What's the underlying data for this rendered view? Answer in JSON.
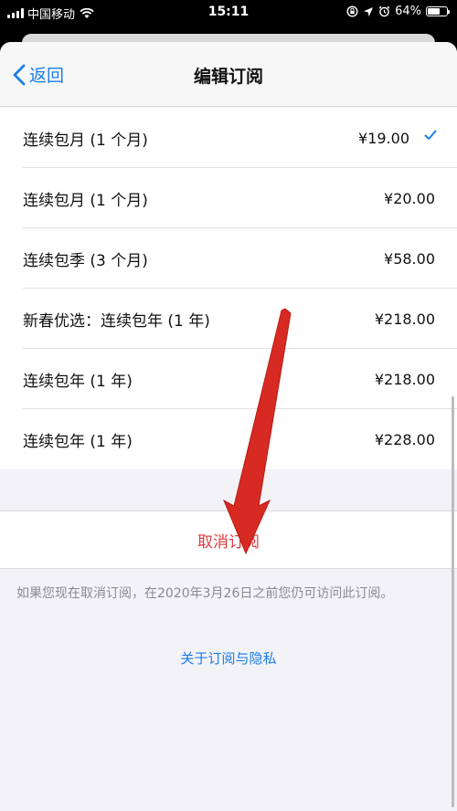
{
  "status": {
    "carrier": "中国移动",
    "time": "15:11",
    "battery": "64%",
    "battery_level": 0.64
  },
  "nav": {
    "back_label": "返回",
    "title": "编辑订阅"
  },
  "plans": [
    {
      "name": "连续包月 (1 个月)",
      "price": "¥19.00",
      "selected": true
    },
    {
      "name": "连续包月 (1 个月)",
      "price": "¥20.00",
      "selected": false
    },
    {
      "name": "连续包季 (3 个月)",
      "price": "¥58.00",
      "selected": false
    },
    {
      "name": "新春优选：连续包年 (1 年)",
      "price": "¥218.00",
      "selected": false
    },
    {
      "name": "连续包年 (1 年)",
      "price": "¥218.00",
      "selected": false
    },
    {
      "name": "连续包年 (1 年)",
      "price": "¥228.00",
      "selected": false
    }
  ],
  "cancel": {
    "label": "取消订阅",
    "note": "如果您现在取消订阅，在2020年3月26日之前您仍可访问此订阅。"
  },
  "privacy_link": "关于订阅与隐私",
  "colors": {
    "accent": "#1a7fe8",
    "destructive": "#e0383e",
    "annotation_arrow": "#d62a22"
  }
}
